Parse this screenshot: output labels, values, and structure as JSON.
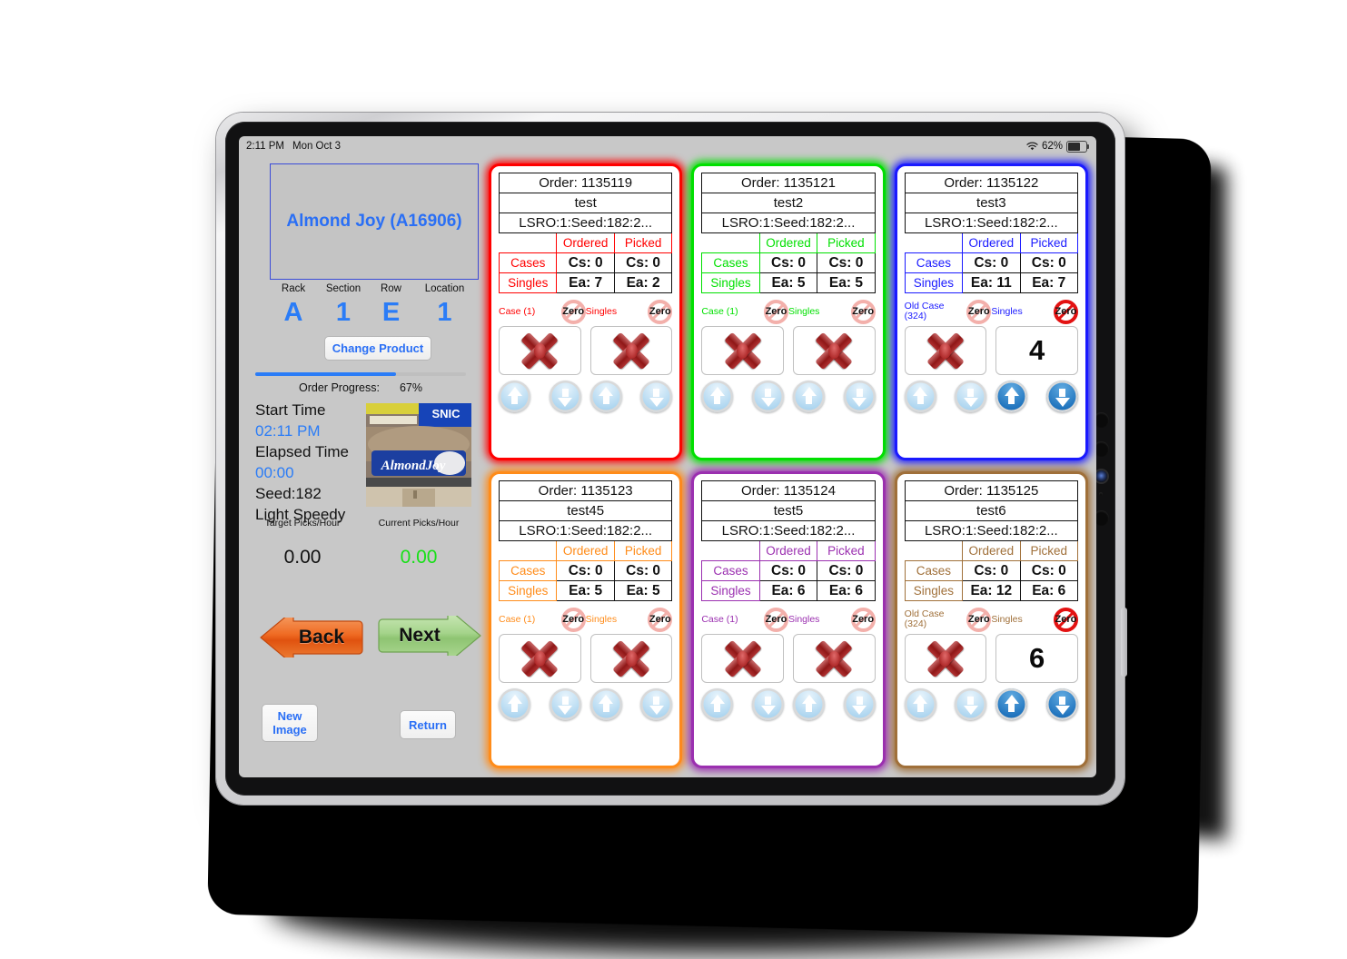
{
  "status_bar": {
    "time": "2:11 PM",
    "date": "Mon Oct 3",
    "battery_percent": "62%",
    "wifi_icon": "wifi-icon",
    "battery_icon": "battery-icon"
  },
  "left_panel": {
    "product_name": "Almond Joy (A16906)",
    "location_headers": [
      "Rack",
      "Section",
      "Row",
      "Location"
    ],
    "location_values": [
      "A",
      "1",
      "E",
      "1"
    ],
    "change_product_label": "Change Product",
    "order_progress_label": "Order Progress:",
    "order_progress_value": "67%",
    "order_progress_percent": 67,
    "start_time_label": "Start Time",
    "start_time_value": "02:11 PM",
    "elapsed_time_label": "Elapsed Time",
    "elapsed_time_value": "00:00",
    "seed_label": "Seed:182",
    "mode_label": "Light Speedy",
    "target_picks_label": "Target Picks/Hour",
    "target_picks_value": "0.00",
    "current_picks_label": "Current Picks/Hour",
    "current_picks_value": "0.00",
    "back_label": "Back",
    "next_label": "Next",
    "new_image_label_1": "New",
    "new_image_label_2": "Image",
    "return_label": "Return",
    "product_image_alt": "almond-joy-shelf-photo"
  },
  "table_headers": {
    "ordered": "Ordered",
    "picked": "Picked",
    "cases": "Cases",
    "singles": "Singles"
  },
  "colors": {
    "card1": "#ff0000",
    "card2": "#00e000",
    "card3": "#1a1aff",
    "card4": "#ff8c1a",
    "card5": "#9b30b0",
    "card6": "#a0703a",
    "accent_blue": "#2a7cf7",
    "green_value": "#17e017",
    "zero_on": "#e31212",
    "zero_off": "#f3b0ab"
  },
  "cards": [
    {
      "order": "Order: 1135119",
      "name": "test",
      "lsro": "LSRO:1:Seed:182:2...",
      "cases_ordered": "Cs: 0",
      "cases_picked": "Cs: 0",
      "singles_ordered": "Ea: 7",
      "singles_picked": "Ea: 2",
      "case_label": "Case (1)",
      "singles_label": "Singles",
      "case_zero": "Zero",
      "singles_zero": "Zero",
      "case_zero_enabled": false,
      "singles_zero_enabled": false,
      "case_value": "",
      "singles_value": "",
      "case_is_x": true,
      "singles_is_x": true,
      "case_steps_active": false,
      "singles_steps_active": false,
      "color_key": "card1"
    },
    {
      "order": "Order: 1135121",
      "name": "test2",
      "lsro": "LSRO:1:Seed:182:2...",
      "cases_ordered": "Cs: 0",
      "cases_picked": "Cs: 0",
      "singles_ordered": "Ea: 5",
      "singles_picked": "Ea: 5",
      "case_label": "Case (1)",
      "singles_label": "Singles",
      "case_zero": "Zero",
      "singles_zero": "Zero",
      "case_zero_enabled": false,
      "singles_zero_enabled": false,
      "case_value": "",
      "singles_value": "",
      "case_is_x": true,
      "singles_is_x": true,
      "case_steps_active": false,
      "singles_steps_active": false,
      "color_key": "card2"
    },
    {
      "order": "Order: 1135122",
      "name": "test3",
      "lsro": "LSRO:1:Seed:182:2...",
      "cases_ordered": "Cs: 0",
      "cases_picked": "Cs: 0",
      "singles_ordered": "Ea: 11",
      "singles_picked": "Ea: 7",
      "case_label": "Old Case (324)",
      "singles_label": "Singles",
      "case_zero": "Zero",
      "singles_zero": "Zero",
      "case_zero_enabled": false,
      "singles_zero_enabled": true,
      "case_value": "",
      "singles_value": "4",
      "case_is_x": true,
      "singles_is_x": false,
      "case_steps_active": false,
      "singles_steps_active": true,
      "color_key": "card3"
    },
    {
      "order": "Order: 1135123",
      "name": "test45",
      "lsro": "LSRO:1:Seed:182:2...",
      "cases_ordered": "Cs: 0",
      "cases_picked": "Cs: 0",
      "singles_ordered": "Ea: 5",
      "singles_picked": "Ea: 5",
      "case_label": "Case (1)",
      "singles_label": "Singles",
      "case_zero": "Zero",
      "singles_zero": "Zero",
      "case_zero_enabled": false,
      "singles_zero_enabled": false,
      "case_value": "",
      "singles_value": "",
      "case_is_x": true,
      "singles_is_x": true,
      "case_steps_active": false,
      "singles_steps_active": false,
      "color_key": "card4"
    },
    {
      "order": "Order: 1135124",
      "name": "test5",
      "lsro": "LSRO:1:Seed:182:2...",
      "cases_ordered": "Cs: 0",
      "cases_picked": "Cs: 0",
      "singles_ordered": "Ea: 6",
      "singles_picked": "Ea: 6",
      "case_label": "Case (1)",
      "singles_label": "Singles",
      "case_zero": "Zero",
      "singles_zero": "Zero",
      "case_zero_enabled": false,
      "singles_zero_enabled": false,
      "case_value": "",
      "singles_value": "",
      "case_is_x": true,
      "singles_is_x": true,
      "case_steps_active": false,
      "singles_steps_active": false,
      "color_key": "card5"
    },
    {
      "order": "Order: 1135125",
      "name": "test6",
      "lsro": "LSRO:1:Seed:182:2...",
      "cases_ordered": "Cs: 0",
      "cases_picked": "Cs: 0",
      "singles_ordered": "Ea: 12",
      "singles_picked": "Ea: 6",
      "case_label": "Old Case (324)",
      "singles_label": "Singles",
      "case_zero": "Zero",
      "singles_zero": "Zero",
      "case_zero_enabled": false,
      "singles_zero_enabled": true,
      "case_value": "",
      "singles_value": "6",
      "case_is_x": true,
      "singles_is_x": false,
      "case_steps_active": false,
      "singles_steps_active": true,
      "color_key": "card6"
    }
  ]
}
